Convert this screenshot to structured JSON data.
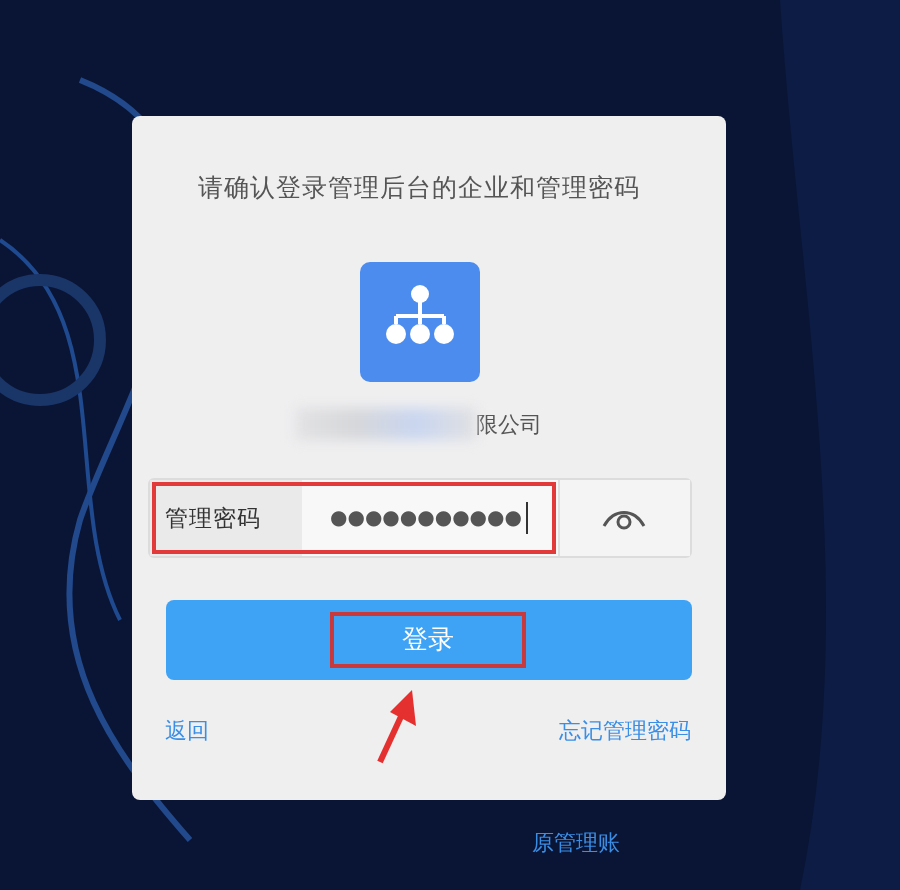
{
  "dialog": {
    "title": "请确认登录管理后台的企业和管理密码",
    "company_name": "限公司"
  },
  "password": {
    "label": "管理密码",
    "value": "●●●●●●●●●●●",
    "highlighted": true
  },
  "login_button": {
    "label": "登录",
    "highlighted": true
  },
  "links": [
    {
      "label": "返回"
    },
    {
      "label": "忘记管理密码"
    }
  ],
  "annotation_arrow": true,
  "footer_link": "原管理账"
}
